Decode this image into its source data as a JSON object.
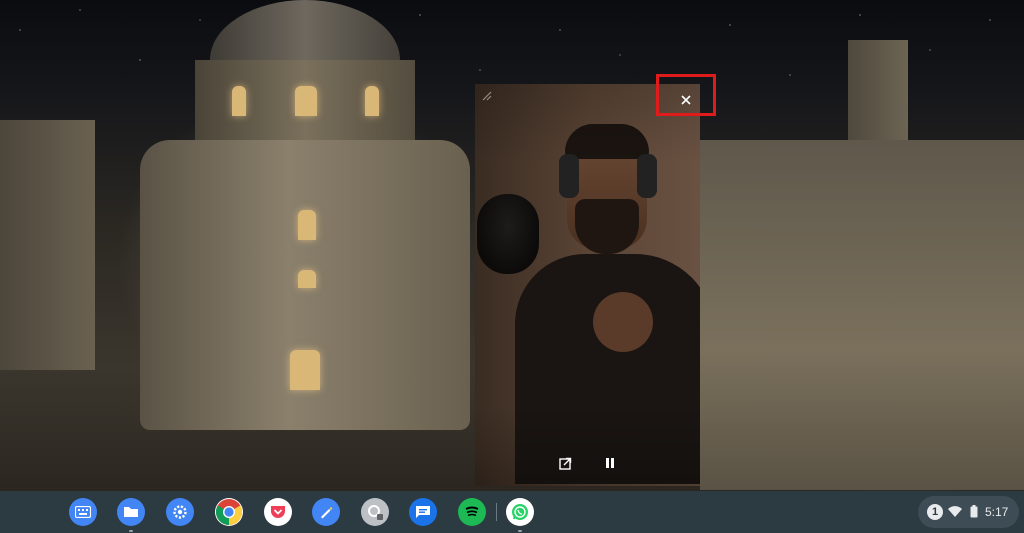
{
  "pip_player": {
    "resize_icon": "resize-handle-icon",
    "close_icon": "close-icon",
    "open_icon": "open-in-new-icon",
    "pause_icon": "pause-icon",
    "highlight_color": "#e01b1b"
  },
  "shelf": {
    "apps": [
      {
        "name": "keyboard-app",
        "icon": "keyboard-icon",
        "color": "#4285f4"
      },
      {
        "name": "files-app",
        "icon": "folder-icon",
        "color": "#4285f4"
      },
      {
        "name": "settings-app",
        "icon": "gear-icon",
        "color": "#4285f4"
      },
      {
        "name": "chrome-app",
        "icon": "chrome-icon",
        "color": "#34a853"
      },
      {
        "name": "pocket-app",
        "icon": "pocket-icon",
        "color": "#ef3f56"
      },
      {
        "name": "keep-app",
        "icon": "pen-icon",
        "color": "#4285f4"
      },
      {
        "name": "search-app",
        "icon": "search-app-icon",
        "color": "#9aa0a6"
      },
      {
        "name": "messages-app",
        "icon": "message-icon",
        "color": "#1a73e8"
      },
      {
        "name": "spotify-app",
        "icon": "spotify-icon",
        "color": "#1db954"
      },
      {
        "name": "whatsapp-app",
        "icon": "whatsapp-icon",
        "color": "#25d366"
      }
    ],
    "status": {
      "notification_count": "1",
      "time": "5:17"
    }
  }
}
